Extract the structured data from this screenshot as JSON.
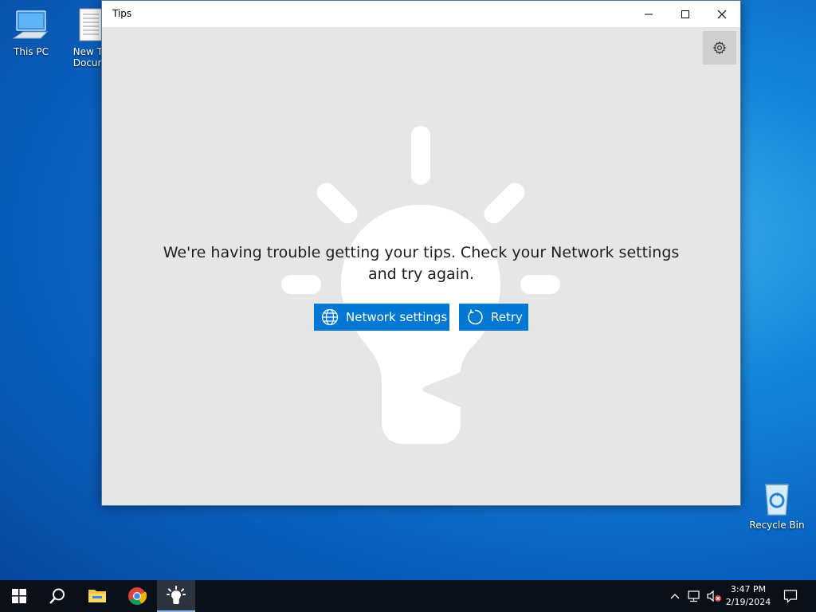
{
  "desktop": {
    "icons": [
      {
        "label": "This PC",
        "icon": "computer-icon"
      },
      {
        "label_line1": "New Te",
        "label_line2": "Docum",
        "icon": "text-document-icon"
      },
      {
        "label": "Recycle Bin",
        "icon": "recycle-bin-icon"
      }
    ]
  },
  "window": {
    "title": "Tips",
    "controls": {
      "minimize": "minimize-icon",
      "maximize": "maximize-icon",
      "close": "close-icon"
    },
    "settings_icon": "gear-icon"
  },
  "content": {
    "message_line1": "We're having trouble getting your tips. Check your Network settings",
    "message_line2": "and try again.",
    "network_button": "Network settings",
    "retry_button": "Retry",
    "network_icon": "globe-icon",
    "retry_icon": "refresh-icon",
    "background_icon": "lightbulb-icon"
  },
  "taskbar": {
    "apps": [
      "start-icon",
      "search-icon",
      "file-explorer-icon",
      "chrome-icon",
      "tips-icon"
    ],
    "active_app": "Tips",
    "tray": [
      "chevron-up-icon",
      "network-icon",
      "volume-muted-icon"
    ],
    "time": "3:47 PM",
    "date": "2/19/2024",
    "notification_icon": "notification-icon"
  },
  "colors": {
    "accent": "#0078d4",
    "window_bg": "#e6e6e6",
    "taskbar_bg": "#0a0f18",
    "desktop": "#0a63c2"
  }
}
